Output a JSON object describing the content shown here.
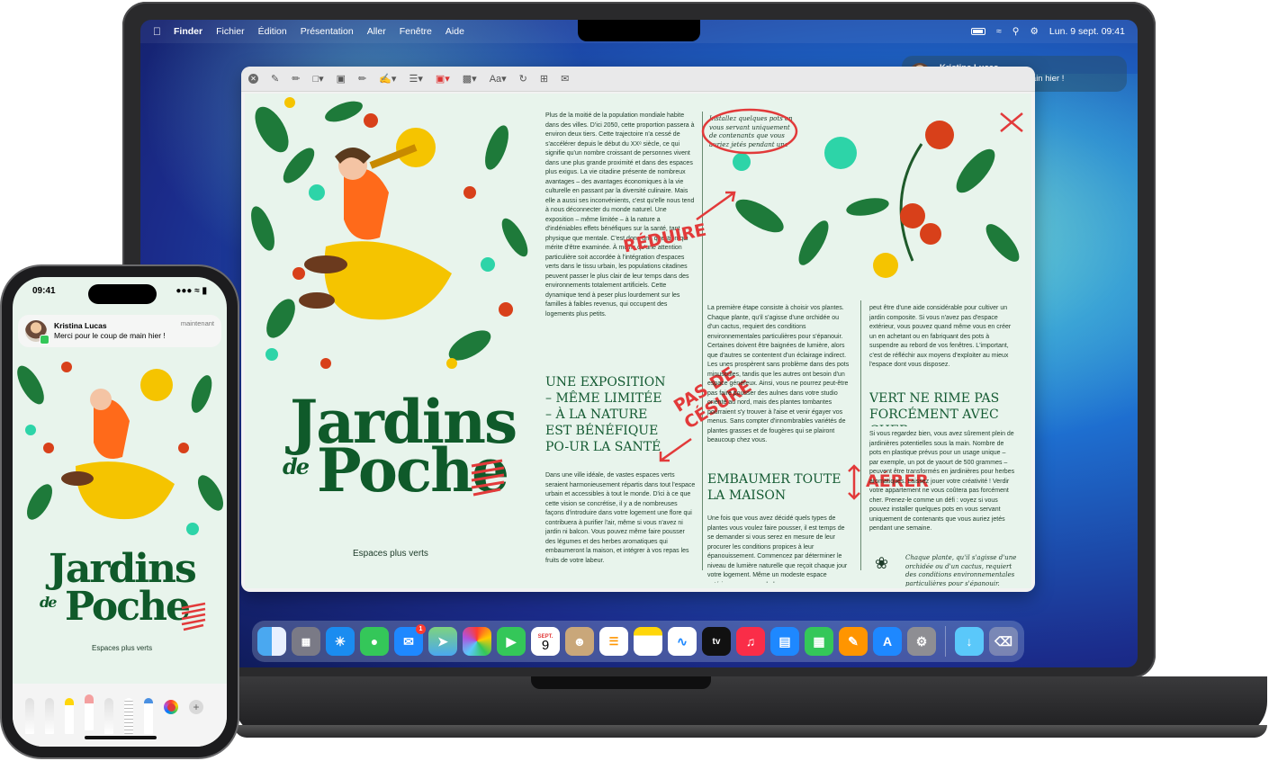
{
  "mac": {
    "menubar": {
      "items": [
        "Finder",
        "Fichier",
        "Édition",
        "Présentation",
        "Aller",
        "Fenêtre",
        "Aide"
      ],
      "clock": "Lun. 9 sept.  09:41"
    },
    "notification": {
      "sender": "Kristina Lucas",
      "message": "Merci pour le coup de main hier !"
    },
    "document": {
      "title_line1": "Jardins",
      "title_de": "de",
      "title_line2": "Poche",
      "subtitle": "Espaces plus verts",
      "col1_text": "Plus de la moitié de la population mondiale habite dans des villes. D'ici 2050, cette proportion passera à environ deux tiers. Cette trajectoire n'a cessé de s'accélérer depuis le début du XXᵉ siècle, ce qui signifie qu'un nombre croissant de personnes vivent dans une plus grande proximité et dans des espaces plus exigus. La vie citadine présente de nombreux avantages – des avantages économiques à la vie culturelle en passant par la diversité culinaire. Mais elle a aussi ses inconvénients, c'est qu'elle nous tend à nous déconnecter du monde naturel. Une exposition – même limitée – à la nature a d'indéniables effets bénéfiques sur la santé, tant physique que mentale. C'est donc une question qui mérite d'être examinée. À moins qu'une attention particulière soit accordée à l'intégration d'espaces verts dans le tissu urbain, les populations citadines peuvent passer le plus clair de leur temps dans des environnements totalement artificiels. Cette dynamique tend à peser plus lourdement sur les familles à faibles revenus, qui occupent des logements plus petits.",
      "heading1": "UNE EXPOSITION – MÊME LIMITÉE – À LA NATURE EST BÉNÉFIQUE PO-UR LA SANTÉ",
      "col1_text2": "Dans une ville idéale, de vastes espaces verts seraient harmonieusement répartis dans tout l'espace urbain et accessibles à tout le monde. D'ici à ce que cette vision se concrétise, il y a de nombreuses façons d'introduire dans votre logement une flore qui contribuera à purifier l'air, même si vous n'avez ni jardin ni balcon. Vous pouvez même faire pousser des légumes et des herbes aromatiques qui embaumeront la maison, et intégrer à vos repas les fruits de votre labeur.",
      "handwritten_top": "Installez quelques pots en vous servant uniquement de contenants que vous auriez jetés pendant une semaine.",
      "col2_text": "La première étape consiste à choisir vos plantes. Chaque plante, qu'il s'agisse d'une orchidée ou d'un cactus, requiert des conditions environnementales particulières pour s'épanouir. Certaines doivent être baignées de lumière, alors que d'autres se contentent d'un éclairage indirect. Les unes prospèrent sans problème dans des pots minuscules, tandis que les autres ont besoin d'un espace généreux. Ainsi, vous ne pourrez peut-être pas faire pousser des aulnes dans votre studio orienté au nord, mais des plantes tombantes pourraient s'y trouver à l'aise et venir égayer vos menus. Sans compter d'innombrables variétés de plantes grasses et de fougères qui se plairont beaucoup chez vous.",
      "heading2": "EMBAUMER TOUTE LA MAISON",
      "col2_text2": "Une fois que vous avez décidé quels types de plantes vous voulez faire pousser, il est temps de se demander si vous serez en mesure de leur procurer les conditions propices à leur épanouissement. Commencez par déterminer le niveau de lumière naturelle que reçoit chaque jour votre logement. Même un modeste espace extérieur, comme un balcon,",
      "col3_text": "peut être d'une aide considérable pour cultiver un jardin composite. Si vous n'avez pas d'espace extérieur, vous pouvez quand même vous en créer un en achetant ou en fabriquant des pots à suspendre au rebord de vos fenêtres. L'important, c'est de réfléchir aux moyens d'exploiter au mieux l'espace dont vous disposez.",
      "heading3": "VERT NE RIME PAS FORCÉMENT AVEC CHER",
      "col3_text2": "Si vous regardez bien, vous avez sûrement plein de jardinières potentielles sous la main. Nombre de pots en plastique prévus pour un usage unique – par exemple, un pot de yaourt de 500 grammes – peuvent être transformés en jardinières pour herbes aromatiques. Laissez jouer votre créativité ! Verdir votre appartement ne vous coûtera pas forcément cher. Prenez-le comme un défi : voyez si vous pouvez installer quelques pots en vous servant uniquement de contenants que vous auriez jetés pendant une semaine.",
      "caption": "Chaque plante, qu'il s'agisse d'une orchidée ou d'un cactus, requiert des conditions environnementales particulières pour s'épanouir.",
      "annotations": {
        "reduire": "RÉDUIRE",
        "pas_de_cesure": "PAS DE CÉSURE",
        "aerer": "AÉRER"
      }
    },
    "dock": {
      "mail_badge": "1",
      "calendar_month": "SEPT.",
      "calendar_day": "9",
      "tv_label": "tv",
      "apps": [
        "finder",
        "launchpad",
        "safari",
        "messages",
        "mail",
        "maps",
        "photos",
        "facetime",
        "calendar",
        "contacts",
        "reminders",
        "notes",
        "freeform",
        "tv",
        "music",
        "keynote",
        "numbers",
        "pages",
        "app-store",
        "settings"
      ]
    }
  },
  "phone": {
    "time": "09:41",
    "notification": {
      "sender": "Kristina Lucas",
      "message": "Merci pour le coup de main hier !",
      "time": "maintenant"
    },
    "document": {
      "title_line1": "Jardins",
      "title_de": "de",
      "title_line2": "Poche",
      "subtitle": "Espaces plus verts"
    },
    "tools": [
      "pen",
      "pencil",
      "marker",
      "eraser",
      "lasso",
      "ruler",
      "fountain-pen"
    ]
  },
  "colors": {
    "title_green": "#0f5a2a",
    "annotation_red": "#e23a3a",
    "page_bg": "#e8f4ec"
  }
}
